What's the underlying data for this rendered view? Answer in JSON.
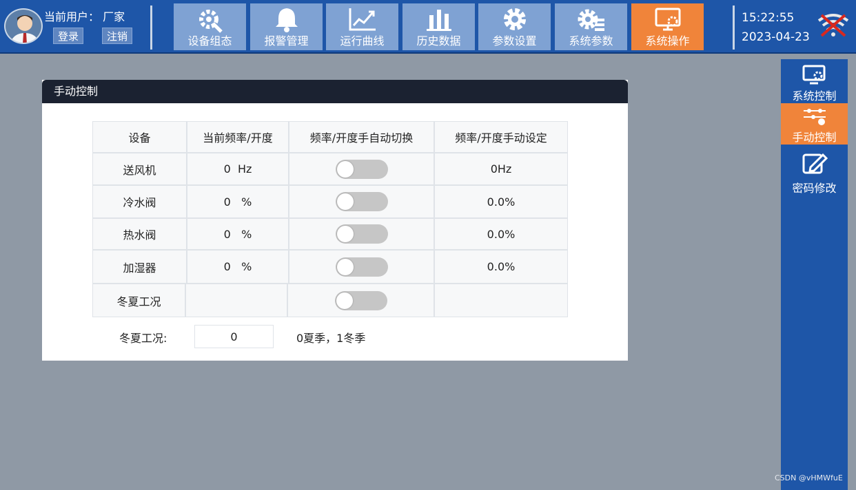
{
  "header": {
    "user_label": "当前用户：  厂家",
    "login_label": "登录",
    "logout_label": "注销",
    "time": "15:22:55",
    "date": "2023-04-23"
  },
  "nav": [
    {
      "label": "设备组态",
      "icon": "gear-wrench-icon",
      "active": false
    },
    {
      "label": "报警管理",
      "icon": "bell-icon",
      "active": false
    },
    {
      "label": "运行曲线",
      "icon": "line-chart-icon",
      "active": false
    },
    {
      "label": "历史数据",
      "icon": "bar-chart-icon",
      "active": false
    },
    {
      "label": "参数设置",
      "icon": "gear-icon",
      "active": false
    },
    {
      "label": "系统参数",
      "icon": "gear-list-icon",
      "active": false
    },
    {
      "label": "系统操作",
      "icon": "monitor-gear-icon",
      "active": true
    }
  ],
  "sidebar": [
    {
      "label": "系统控制",
      "icon": "monitor-gear-icon",
      "active": false
    },
    {
      "label": "手动控制",
      "icon": "sliders-icon",
      "active": true
    },
    {
      "label": "密码修改",
      "icon": "edit-icon",
      "active": false
    }
  ],
  "panel": {
    "title": "手动控制",
    "headers": [
      "设备",
      "当前频率/开度",
      "频率/开度手自动切换",
      "频率/开度手动设定"
    ],
    "rows": [
      {
        "device": "送风机",
        "current": "0  Hz",
        "toggle_on": false,
        "setpoint": "0Hz"
      },
      {
        "device": "冷水阀",
        "current": "0   %",
        "toggle_on": false,
        "setpoint": "0.0%"
      },
      {
        "device": "热水阀",
        "current": "0   %",
        "toggle_on": false,
        "setpoint": "0.0%"
      },
      {
        "device": "加湿器",
        "current": "0   %",
        "toggle_on": false,
        "setpoint": "0.0%"
      },
      {
        "device": "冬夏工况",
        "current": "",
        "toggle_on": false,
        "setpoint": ""
      }
    ],
    "season_label": "冬夏工况:",
    "season_value": "0",
    "season_hint": "0夏季，1冬季"
  },
  "watermark": "CSDN @vHMWfuE",
  "colors": {
    "topbar": "#1e56a8",
    "nav_button": "#7fa2d3",
    "active": "#f0843a",
    "panel_header": "#1b2231",
    "background": "#8f99a5"
  }
}
